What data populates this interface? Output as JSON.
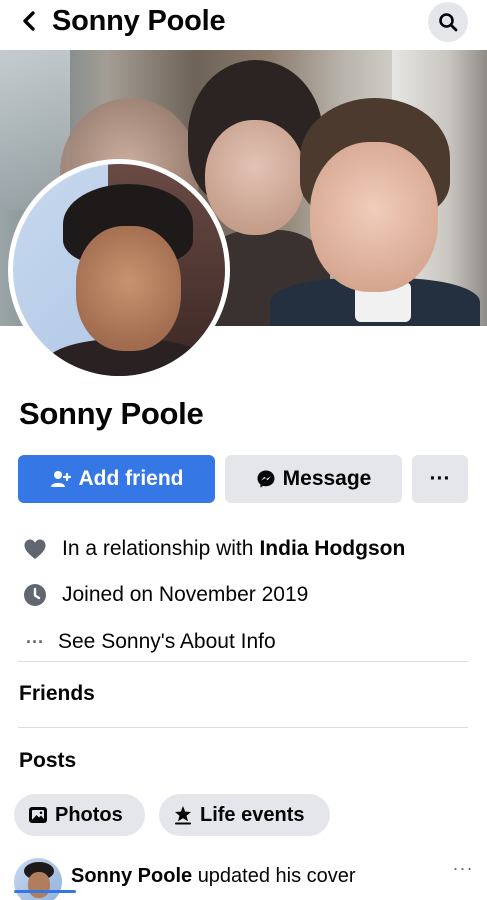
{
  "header": {
    "title": "Sonny Poole",
    "back_icon": "chevron-left-icon",
    "search_icon": "search-icon"
  },
  "profile": {
    "name": "Sonny Poole"
  },
  "actions": {
    "add_friend": "Add friend",
    "message": "Message",
    "more": "···"
  },
  "info": {
    "relationship_prefix": "In a relationship with",
    "relationship_partner": "India Hodgson",
    "joined": "Joined on November 2019",
    "about": "See Sonny's About Info",
    "about_dots": "···"
  },
  "sections": {
    "friends": "Friends",
    "posts": "Posts"
  },
  "chips": {
    "photos": "Photos",
    "life_events": "Life events"
  },
  "post": {
    "author": "Sonny Poole",
    "action": "updated his cover",
    "more": "···"
  },
  "colors": {
    "primary": "#3578e5",
    "button_gray": "#e4e6eb",
    "text": "#050505",
    "icon_gray": "#65676b"
  }
}
